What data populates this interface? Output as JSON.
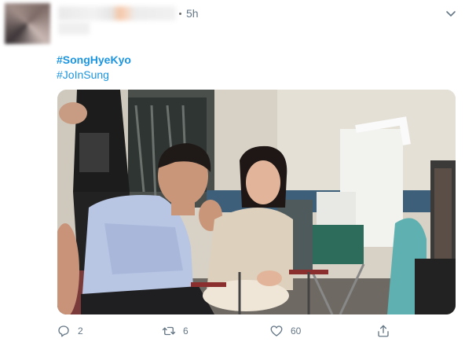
{
  "tweet": {
    "time": "5h",
    "hashtags": [
      "#SongHyeKyo",
      "#JoInSung"
    ]
  },
  "actions": {
    "reply_count": "2",
    "retweet_count": "6",
    "like_count": "60"
  },
  "icons": {
    "caret": "chevron-down-icon",
    "reply": "reply-icon",
    "retweet": "retweet-icon",
    "like": "heart-icon",
    "share": "share-icon"
  },
  "colors": {
    "hashtag": "#1b95e0",
    "secondary_text": "#657786"
  }
}
